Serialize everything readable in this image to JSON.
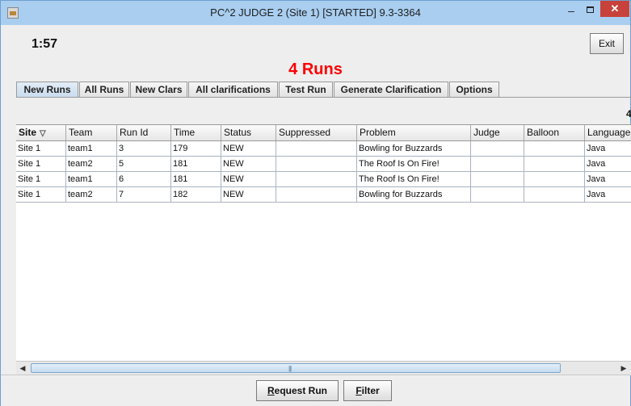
{
  "window": {
    "title": "PC^2 JUDGE 2 (Site 1) [STARTED] 9.3-3364",
    "minimize_glyph": "–",
    "close_glyph": "✕"
  },
  "header": {
    "clock": "1:57",
    "exit_label": "Exit",
    "runs_title": "4 Runs",
    "runs_title_color": "#ff0000"
  },
  "tabs": [
    {
      "label": "New Runs",
      "active": true
    },
    {
      "label": "All Runs",
      "active": false
    },
    {
      "label": "New Clars",
      "active": false
    },
    {
      "label": "All clarifications",
      "active": false
    },
    {
      "label": "Test Run",
      "active": false
    },
    {
      "label": "Generate Clarification",
      "active": false
    },
    {
      "label": "Options",
      "active": false
    }
  ],
  "table": {
    "count_label": "4",
    "sort_icon": "▽",
    "columns": [
      "Site",
      "Team",
      "Run Id",
      "Time",
      "Status",
      "Suppressed",
      "Problem",
      "Judge",
      "Balloon",
      "Language"
    ],
    "rows": [
      [
        "Site 1",
        "team1",
        "3",
        "179",
        "NEW",
        "",
        "Bowling for Buzzards",
        "",
        "",
        "Java"
      ],
      [
        "Site 1",
        "team2",
        "5",
        "181",
        "NEW",
        "",
        "The Roof Is On Fire!",
        "",
        "",
        "Java"
      ],
      [
        "Site 1",
        "team1",
        "6",
        "181",
        "NEW",
        "",
        "The Roof Is On Fire!",
        "",
        "",
        "Java"
      ],
      [
        "Site 1",
        "team2",
        "7",
        "182",
        "NEW",
        "",
        "Bowling for Buzzards",
        "",
        "",
        "Java"
      ]
    ]
  },
  "scrollbar": {
    "left_arrow": "◀",
    "right_arrow": "▶",
    "grip": "|||"
  },
  "buttons": {
    "request_run_mnemonic": "R",
    "request_run_rest": "equest Run",
    "filter_mnemonic": "F",
    "filter_rest": "ilter"
  }
}
